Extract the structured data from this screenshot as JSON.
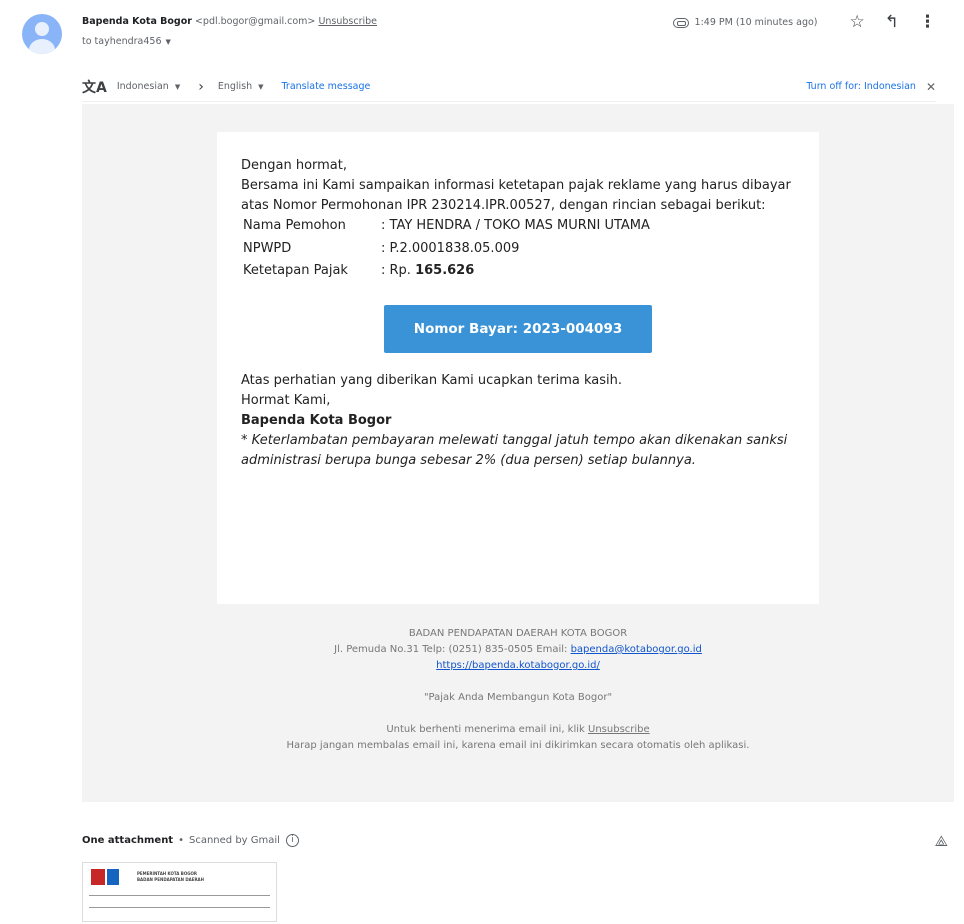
{
  "header": {
    "sender_name": "Bapenda Kota Bogor",
    "sender_email": "<pdl.bogor@gmail.com>",
    "unsubscribe_label": "Unsubscribe",
    "to_label": "to tayhendra456",
    "time": "1:49 PM (10 minutes ago)",
    "icons": [
      "attachment-icon",
      "star-icon",
      "reply-icon",
      "more-vert-icon"
    ]
  },
  "translate": {
    "icon": "translate-icon",
    "source_lang": "Indonesian",
    "target_lang": "English",
    "translate_label": "Translate message",
    "turn_off_label": "Turn off for: Indonesian",
    "close_icon": "close-icon"
  },
  "body": {
    "greeting": "Dengan hormat,",
    "intro": "Bersama ini Kami sampaikan informasi ketetapan pajak reklame yang harus dibayar atas Nomor Permohonan IPR 230214.IPR.00527, dengan rincian sebagai berikut:",
    "details": [
      {
        "label": "Nama Pemohon",
        "value": ": TAY HENDRA / TOKO MAS MURNI UTAMA"
      },
      {
        "label": "NPWPD",
        "value": ": P.2.0001838.05.009"
      },
      {
        "label": "Ketetapan Pajak",
        "prefix": ": Rp. ",
        "value": "165.626"
      }
    ],
    "pay_button": "Nomor Bayar: 2023-004093",
    "button_color": "#3a93d6",
    "thanks": "Atas perhatian yang diberikan Kami ucapkan terima kasih.",
    "regards": "Hormat Kami,",
    "signature": "Bapenda Kota Bogor",
    "note": "* Keterlambatan pembayaran melewati tanggal jatuh tempo akan dikenakan sanksi administrasi berupa bunga sebesar 2% (dua persen) setiap bulannya."
  },
  "footer": {
    "org": "BADAN PENDAPATAN DAERAH KOTA BOGOR",
    "address": "Jl. Pemuda No.31 Telp: (0251) 835-0505 Email: ",
    "email": "bapenda@kotabogor.go.id",
    "website": "https://bapenda.kotabogor.go.id/",
    "slogan": "\"Pajak Anda Membangun Kota Bogor\"",
    "unsub_text": "Untuk berhenti menerima email ini, klik ",
    "unsub_link": "Unsubscribe",
    "noreply": "Harap jangan membalas email ini, karena email ini dikirimkan secara otomatis oleh aplikasi."
  },
  "attachments": {
    "title": "One attachment",
    "separator": "•",
    "scanned": "Scanned by Gmail",
    "info_icon": "info-icon",
    "drive_icon": "add-to-drive-icon",
    "thumb_lines": [
      "PEMERINTAH KOTA BOGOR",
      "BADAN PENDAPATAN DAERAH"
    ]
  }
}
